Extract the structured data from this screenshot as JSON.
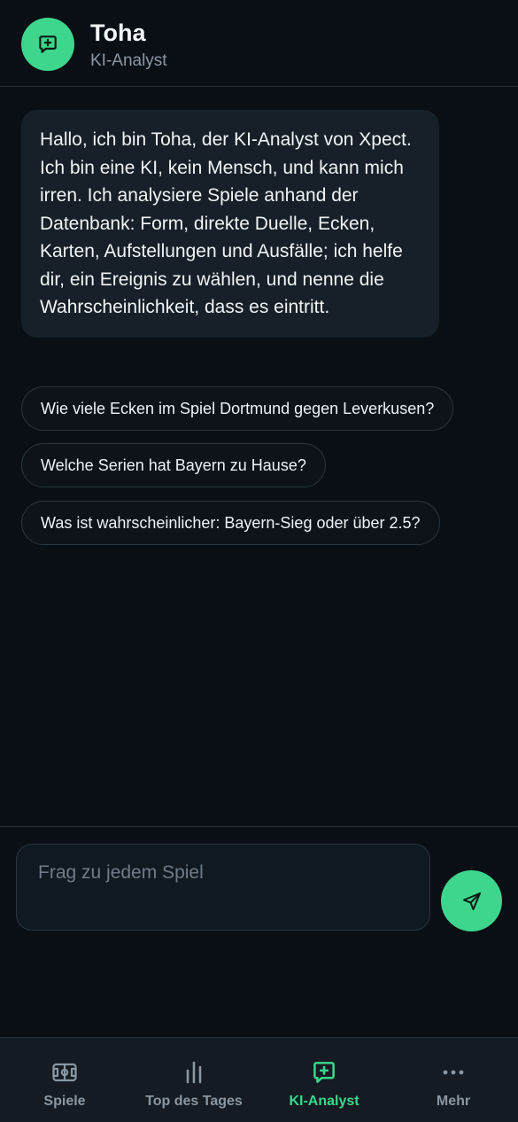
{
  "header": {
    "title": "Toha",
    "subtitle": "KI-Analyst",
    "avatar_icon": "chat-sparkle-icon"
  },
  "chat": {
    "messages": [
      {
        "sender": "assistant",
        "text": "Hallo, ich bin Toha, der KI-Analyst von Xpect. Ich bin eine KI, kein Mensch, und kann mich irren. Ich analysiere Spiele anhand der Datenbank: Form, direkte Duelle, Ecken, Karten, Aufstellungen und Ausfälle; ich helfe dir, ein Ereignis zu wählen, und nenne die Wahrscheinlichkeit, dass es eintritt."
      }
    ],
    "suggestions": [
      "Wie viele Ecken im Spiel Dortmund gegen Leverkusen?",
      "Welche Serien hat Bayern zu Hause?",
      "Was ist wahrscheinlicher: Bayern-Sieg oder über 2.5?"
    ]
  },
  "composer": {
    "value": "",
    "placeholder": "Frag zu jedem Spiel",
    "send_icon": "send-icon"
  },
  "nav": {
    "items": [
      {
        "label": "Spiele",
        "icon": "pitch-icon",
        "active": false
      },
      {
        "label": "Top des Tages",
        "icon": "bar-chart-icon",
        "active": false
      },
      {
        "label": "KI-Analyst",
        "icon": "chat-sparkle-icon",
        "active": true
      },
      {
        "label": "Mehr",
        "icon": "more-dots-icon",
        "active": false
      }
    ]
  },
  "colors": {
    "background": "#0a0f15",
    "accent": "#3dd68c",
    "bubble": "#172028",
    "nav_background": "#141b22",
    "muted_text": "#8a97a3"
  }
}
